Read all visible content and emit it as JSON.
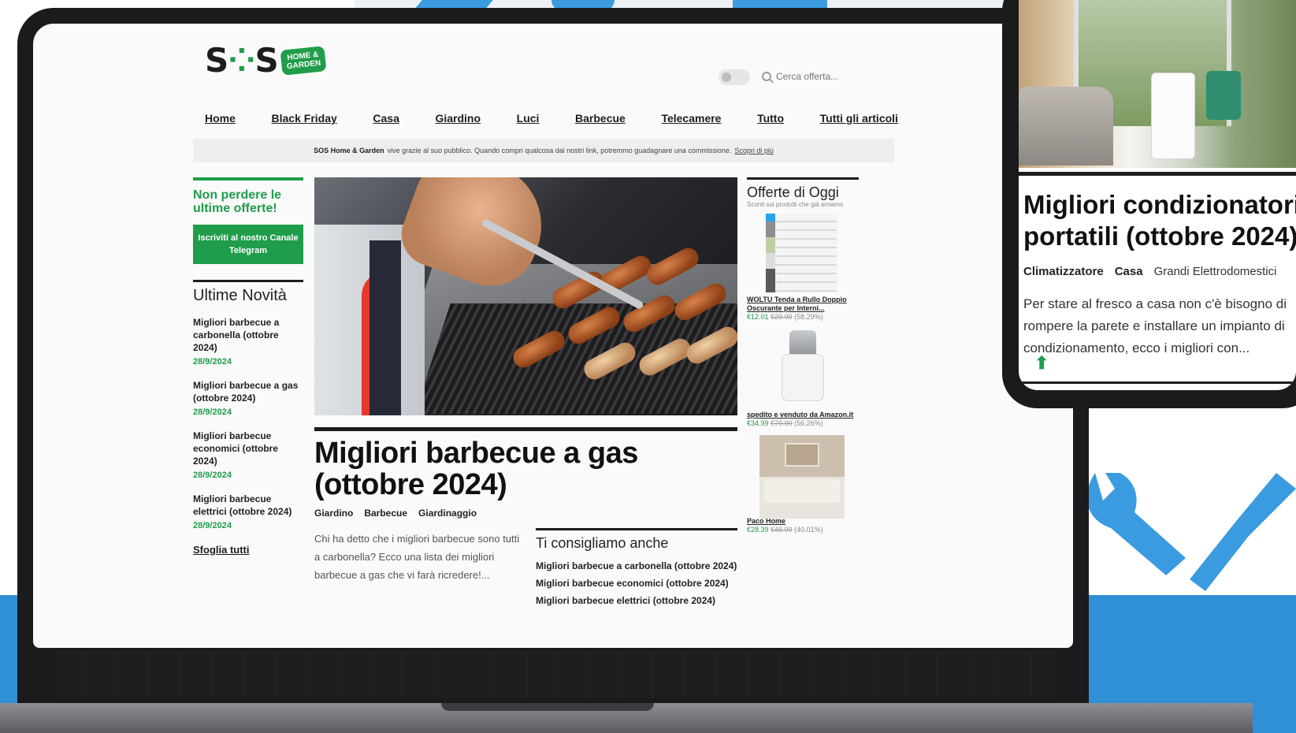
{
  "brand": {
    "logo_text_left": "S",
    "logo_text_right": "S",
    "logo_badge": "HOME & GARDEN",
    "accent_color": "#1f9d4a"
  },
  "header": {
    "search_placeholder": "Cerca offerta..."
  },
  "nav": [
    "Home",
    "Black Friday",
    "Casa",
    "Giardino",
    "Luci",
    "Barbecue",
    "Telecamere",
    "Tutto",
    "Tutti gli articoli"
  ],
  "disclaimer": {
    "brand": "SOS Home & Garden",
    "text": "vive grazie al suo pubblico. Quando compri qualcosa dai nostri link, potremmo guadagnare una commissione.",
    "link": "Scopri di più"
  },
  "sidebar": {
    "promo_title": "Non perdere le ultime offerte!",
    "telegram_button": "Iscriviti al nostro Canale Telegram",
    "latest_heading": "Ultime Novità",
    "latest": [
      {
        "title": "Migliori barbecue a carbonella (ottobre 2024)",
        "date": "28/9/2024"
      },
      {
        "title": "Migliori barbecue a gas (ottobre 2024)",
        "date": "28/9/2024"
      },
      {
        "title": "Migliori barbecue economici (ottobre 2024)",
        "date": "28/9/2024"
      },
      {
        "title": "Migliori barbecue elettrici (ottobre 2024)",
        "date": "28/9/2024"
      }
    ],
    "browse_all": "Sfoglia tutti"
  },
  "article": {
    "title": "Migliori barbecue a gas (ottobre 2024)",
    "tags": [
      "Giardino",
      "Barbecue",
      "Giardinaggio"
    ],
    "excerpt": "Chi ha detto che i migliori barbecue sono tutti a carbonella? Ecco una lista dei migliori barbecue a gas che vi farà ricredere!..."
  },
  "related": {
    "heading": "Ti consigliamo anche",
    "items": [
      "Migliori barbecue a carbonella (ottobre 2024)",
      "Migliori barbecue economici (ottobre 2024)",
      "Migliori barbecue elettrici (ottobre 2024)"
    ]
  },
  "offers": {
    "heading": "Offerte di Oggi",
    "subheading": "Sconti sui prodotti che già amiamo",
    "items": [
      {
        "name": "WOLTU Tenda a Rullo Doppio Oscurante per Interni...",
        "price": "€12.01",
        "old_price": "€29.99",
        "discount": "(58.29%)",
        "image": "roller-blind"
      },
      {
        "name": "spedito e venduto da Amazon.it",
        "price": "€34.99",
        "old_price": "€79.99",
        "discount": "(56.26%)",
        "image": "juicer"
      },
      {
        "name": "Paco Home",
        "price": "€28.39",
        "old_price": "€48.99",
        "discount": "(40.01%)",
        "image": "rug-bedroom"
      }
    ]
  },
  "phone": {
    "title_line1": "Migliori condizionatori",
    "title_line2": "portatili (ottobre 2024)",
    "tags": [
      "Climatizzatore",
      "Casa",
      "Grandi Elettrodomestici"
    ],
    "excerpt_line1": "Per stare al fresco a casa non c'è bisogno di",
    "excerpt_line2": "rompere la parete e installare un impianto di",
    "excerpt_line3": "condizionamento, ecco i migliori con...",
    "scroll_up_icon": "arrow-up-icon"
  }
}
